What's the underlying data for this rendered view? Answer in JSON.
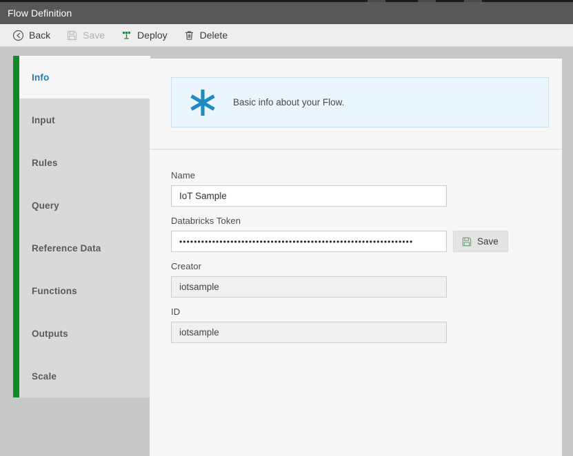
{
  "window": {
    "title": "Flow Definition"
  },
  "toolbar": {
    "items": [
      {
        "label": "Back",
        "icon": "back-arrow-icon",
        "disabled": false
      },
      {
        "label": "Save",
        "icon": "save-disk-icon",
        "disabled": true
      },
      {
        "label": "Deploy",
        "icon": "deploy-icon",
        "disabled": false
      },
      {
        "label": "Delete",
        "icon": "trash-icon",
        "disabled": false
      }
    ]
  },
  "sidebar": {
    "items": [
      {
        "label": "Info",
        "active": true
      },
      {
        "label": "Input",
        "active": false
      },
      {
        "label": "Rules",
        "active": false
      },
      {
        "label": "Query",
        "active": false
      },
      {
        "label": "Reference Data",
        "active": false
      },
      {
        "label": "Functions",
        "active": false
      },
      {
        "label": "Outputs",
        "active": false
      },
      {
        "label": "Scale",
        "active": false
      }
    ]
  },
  "panel": {
    "banner": {
      "icon": "asterisk-icon",
      "text": "Basic info about your Flow."
    },
    "fields": {
      "name": {
        "label": "Name",
        "value": "IoT Sample",
        "placeholder": ""
      },
      "databricks_token": {
        "label": "Databricks Token",
        "value": "••••••••••••••••••••••••••••••••••••••••••••••••••••••••••••••••",
        "placeholder": "",
        "save_label": "Save",
        "save_icon": "save-disk-icon"
      },
      "creator": {
        "label": "Creator",
        "value": "iotsample",
        "placeholder": ""
      },
      "id": {
        "label": "ID",
        "value": "iotsample",
        "placeholder": ""
      }
    }
  },
  "colors": {
    "titlebar": "#585858",
    "accent_green": "#0f8a2a",
    "accent_blue": "#2a7ab0",
    "banner_bg": "#eaf5fc",
    "banner_border": "#c7e2f2",
    "workspace": "#c8c8c8"
  }
}
